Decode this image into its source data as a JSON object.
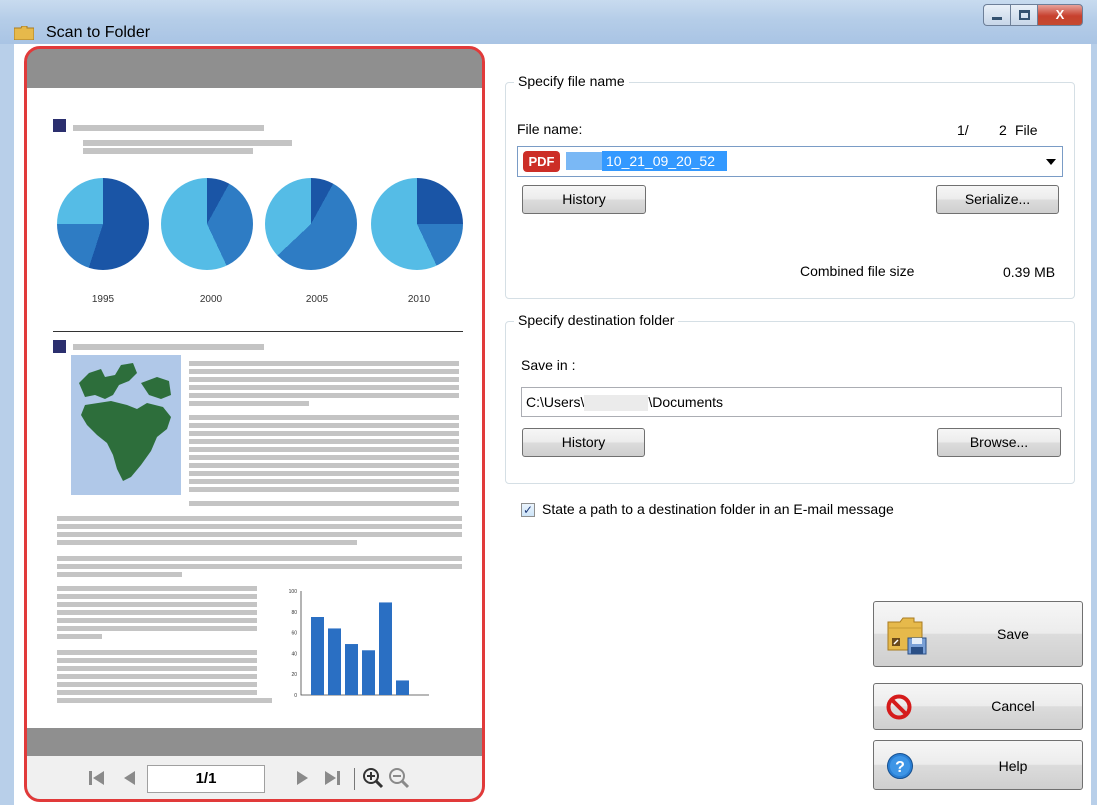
{
  "window": {
    "title": "Scan to Folder",
    "minimize_glyph": "",
    "maximize_glyph": "",
    "close_glyph": "X"
  },
  "preview": {
    "years": [
      "1995",
      "2000",
      "2005",
      "2010"
    ],
    "pies": [
      {
        "dark": 0.55,
        "mid": 0.2
      },
      {
        "dark": 0.08,
        "mid": 0.35
      },
      {
        "dark": 0.08,
        "mid": 0.55
      },
      {
        "dark": 0.25,
        "mid": 0.18
      }
    ],
    "bar_chart": {
      "yticks": [
        "100",
        "80",
        "60",
        "40",
        "20",
        "0"
      ],
      "values": [
        75,
        64,
        49,
        43,
        89,
        14
      ],
      "ylim": [
        0,
        100
      ]
    },
    "nav": {
      "page_indicator": "1/1"
    },
    "colors": {
      "pie_dark": "#1a55a6",
      "pie_mid": "#2e7cc4",
      "pie_light": "#55bce6",
      "bar": "#2a6fc3",
      "map_land": "#2d6e3b",
      "map_water": "#b0c8e8"
    }
  },
  "file_name_group": {
    "label": "Specify file name",
    "file_name_label": "File name:",
    "file_count_current": "1/",
    "file_count_total": "2",
    "file_count_unit": "File",
    "file_type_badge": "PDF",
    "file_name_value": "10_21_09_20_52",
    "history_button": "History",
    "serialize_button": "Serialize...",
    "combined_size_label": "Combined file size",
    "combined_size_value": "0.39 MB"
  },
  "destination_group": {
    "label": "Specify destination folder",
    "save_in_label": "Save in :",
    "path_prefix": "C:\\Users\\",
    "path_suffix": "\\Documents",
    "history_button": "History",
    "browse_button": "Browse..."
  },
  "email_option": {
    "label": "State a path to a destination folder in an E-mail message",
    "checked": true
  },
  "actions": {
    "save": "Save",
    "cancel": "Cancel",
    "help": "Help"
  }
}
